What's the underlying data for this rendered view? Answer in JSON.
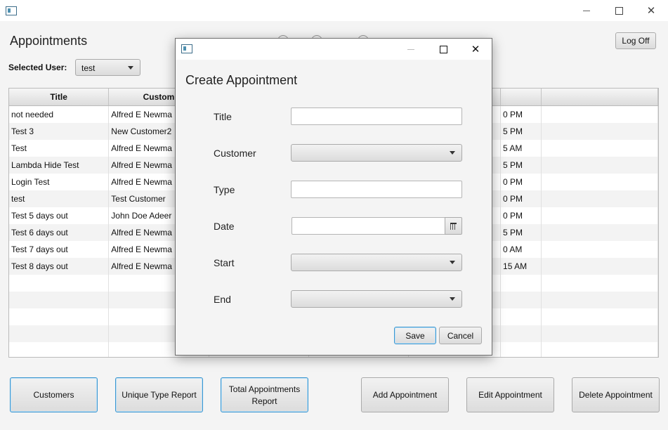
{
  "window": {
    "title": ""
  },
  "page": {
    "title": "Appointments",
    "logoff_label": "Log Off"
  },
  "user": {
    "label": "Selected User:",
    "value": "test"
  },
  "table": {
    "headers": [
      "Title",
      "Custom",
      "",
      "",
      "",
      "",
      ""
    ],
    "rows": [
      {
        "title": "not needed",
        "customer": "Alfred E Newma",
        "time": "0 PM"
      },
      {
        "title": "Test 3",
        "customer": "New Customer2",
        "time": "5 PM"
      },
      {
        "title": "Test",
        "customer": "Alfred E Newma",
        "time": "5 AM"
      },
      {
        "title": "Lambda Hide Test",
        "customer": "Alfred E Newma",
        "time": "5 PM"
      },
      {
        "title": "Login Test",
        "customer": "Alfred E Newma",
        "time": "0 PM"
      },
      {
        "title": "test",
        "customer": "Test Customer",
        "time": "0 PM"
      },
      {
        "title": "Test 5 days out",
        "customer": "John Doe Adeer",
        "time": "0 PM"
      },
      {
        "title": "Test 6 days out",
        "customer": "Alfred E Newma",
        "time": "5 PM"
      },
      {
        "title": "Test 7 days out",
        "customer": "Alfred E Newma",
        "time": "0 AM"
      },
      {
        "title": "Test 8 days out",
        "customer": "Alfred E Newma",
        "time": "15 AM"
      }
    ]
  },
  "bottom_buttons": {
    "customers": "Customers",
    "unique_type_report": "Unique Type Report",
    "total_appointments_report_line1": "Total Appointments",
    "total_appointments_report_line2": "Report",
    "add_appointment": "Add Appointment",
    "edit_appointment": "Edit Appointment",
    "delete_appointment": "Delete Appointment"
  },
  "dialog": {
    "title": "Create Appointment",
    "fields": {
      "title": {
        "label": "Title",
        "value": ""
      },
      "customer": {
        "label": "Customer",
        "value": ""
      },
      "type": {
        "label": "Type",
        "value": ""
      },
      "date": {
        "label": "Date",
        "value": ""
      },
      "start": {
        "label": "Start",
        "value": ""
      },
      "end": {
        "label": "End",
        "value": ""
      }
    },
    "save_label": "Save",
    "cancel_label": "Cancel"
  },
  "icons": {
    "app": "app-icon",
    "minimize": "minimize-icon",
    "maximize": "maximize-icon",
    "close": "close-icon",
    "dropdown": "chevron-down-icon",
    "calendar": "calendar-icon"
  },
  "colors": {
    "focus_border": "#3a96d0",
    "window_bg": "#f4f4f4",
    "row_alt": "#f3f3f3"
  }
}
